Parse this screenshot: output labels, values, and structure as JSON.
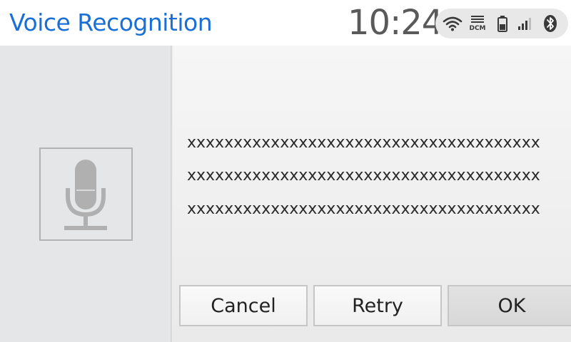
{
  "header": {
    "title": "Voice Recognition",
    "clock": "10:24",
    "status_icons": [
      {
        "name": "wifi-icon"
      },
      {
        "name": "dcm-icon",
        "label": "DCM"
      },
      {
        "name": "battery-icon"
      },
      {
        "name": "signal-icon"
      },
      {
        "name": "bluetooth-icon"
      }
    ]
  },
  "left_panel": {
    "icon": "microphone-icon"
  },
  "message": {
    "lines": [
      "xxxxxxxxxxxxxxxxxxxxxxxxxxxxxxxxxxxxxx",
      "xxxxxxxxxxxxxxxxxxxxxxxxxxxxxxxxxxxxxx",
      "xxxxxxxxxxxxxxxxxxxxxxxxxxxxxxxxxxxxxx"
    ]
  },
  "buttons": {
    "cancel": "Cancel",
    "retry": "Retry",
    "ok": "OK"
  },
  "colors": {
    "title": "#1a6fd6",
    "clock": "#5a5a5a",
    "left_panel": "#e4e6e8"
  }
}
